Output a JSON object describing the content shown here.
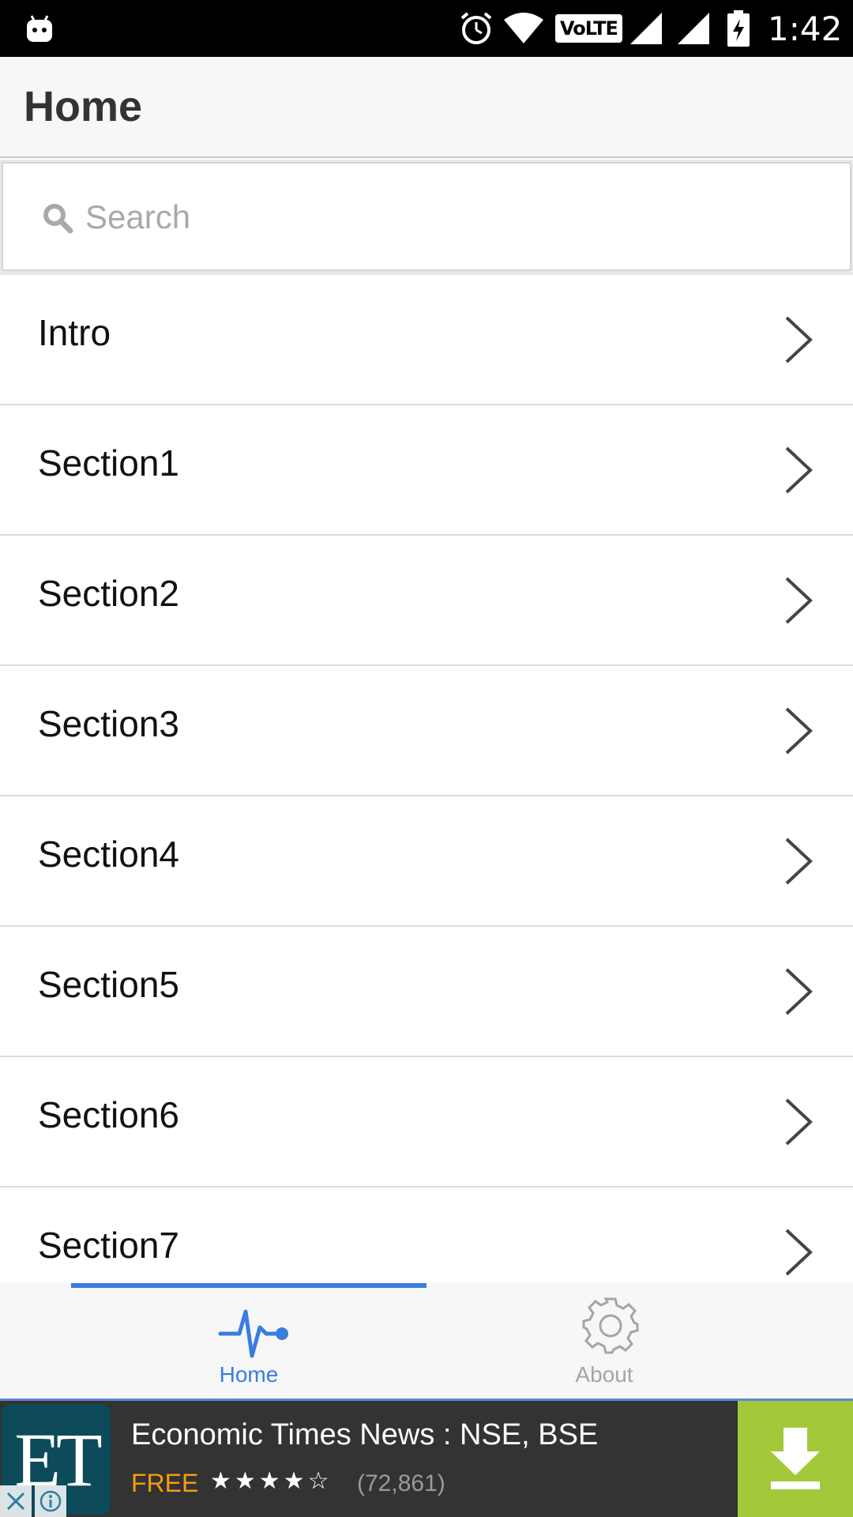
{
  "status_bar": {
    "time": "1:42",
    "volte": "VoLTE",
    "icons": [
      "android-icon",
      "alarm-icon",
      "wifi-icon",
      "signal-icon",
      "signal-icon",
      "battery-charging-icon"
    ]
  },
  "header": {
    "title": "Home"
  },
  "search": {
    "placeholder": "Search",
    "value": ""
  },
  "list": {
    "items": [
      {
        "label": "Intro"
      },
      {
        "label": "Section1"
      },
      {
        "label": "Section2"
      },
      {
        "label": "Section3"
      },
      {
        "label": "Section4"
      },
      {
        "label": "Section5"
      },
      {
        "label": "Section6"
      },
      {
        "label": "Section7"
      }
    ]
  },
  "tabs": {
    "items": [
      {
        "label": "Home",
        "icon": "activity-icon",
        "active": true
      },
      {
        "label": "About",
        "icon": "gear-icon",
        "active": false
      }
    ]
  },
  "ad": {
    "logo_text": "ET",
    "title": "Economic Times News : NSE, BSE",
    "price": "FREE",
    "rating": 4.5,
    "stars": "★★★★☆",
    "reviews": "(72,861)",
    "colors": {
      "logo_bg": "#0d4a5a",
      "download_bg": "#a3c93a",
      "price": "#f39c12"
    }
  },
  "colors": {
    "accent": "#3a7ce0",
    "inactive_tab": "#a5a5a5",
    "header_bg": "#f7f7f7"
  }
}
